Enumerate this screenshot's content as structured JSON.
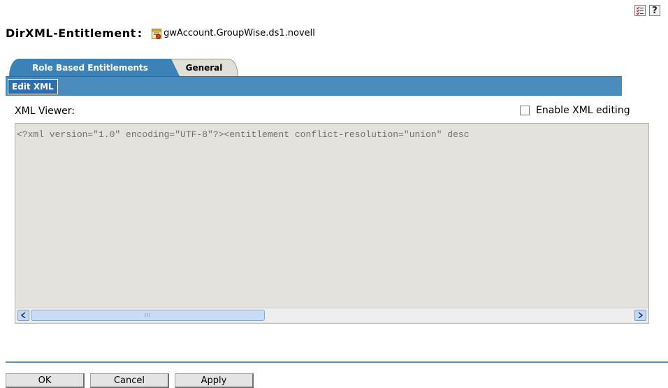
{
  "header": {
    "title": "DirXML-Entitlement",
    "colon": ":",
    "object_name": "gwAccount.GroupWise.ds1.novell",
    "object_icon": "entitlement-object-icon",
    "top_icons": [
      "task-list-icon",
      "help-icon"
    ],
    "help_glyph": "?"
  },
  "tabs": [
    {
      "label": "Role Based Entitlements",
      "active": true
    },
    {
      "label": "General",
      "active": false
    }
  ],
  "subtabs": [
    {
      "label": "Edit XML",
      "active": true
    }
  ],
  "viewer": {
    "label": "XML Viewer:",
    "enable_label": "Enable XML editing",
    "enable_checked": false,
    "content": "<?xml version=\"1.0\" encoding=\"UTF-8\"?><entitlement conflict-resolution=\"union\" desc"
  },
  "buttons": {
    "ok": "OK",
    "cancel": "Cancel",
    "apply": "Apply"
  },
  "colors": {
    "tab_blue": "#3a82b8",
    "bar_blue": "#4b8cbf",
    "xml_background": "#e3e2dc"
  }
}
